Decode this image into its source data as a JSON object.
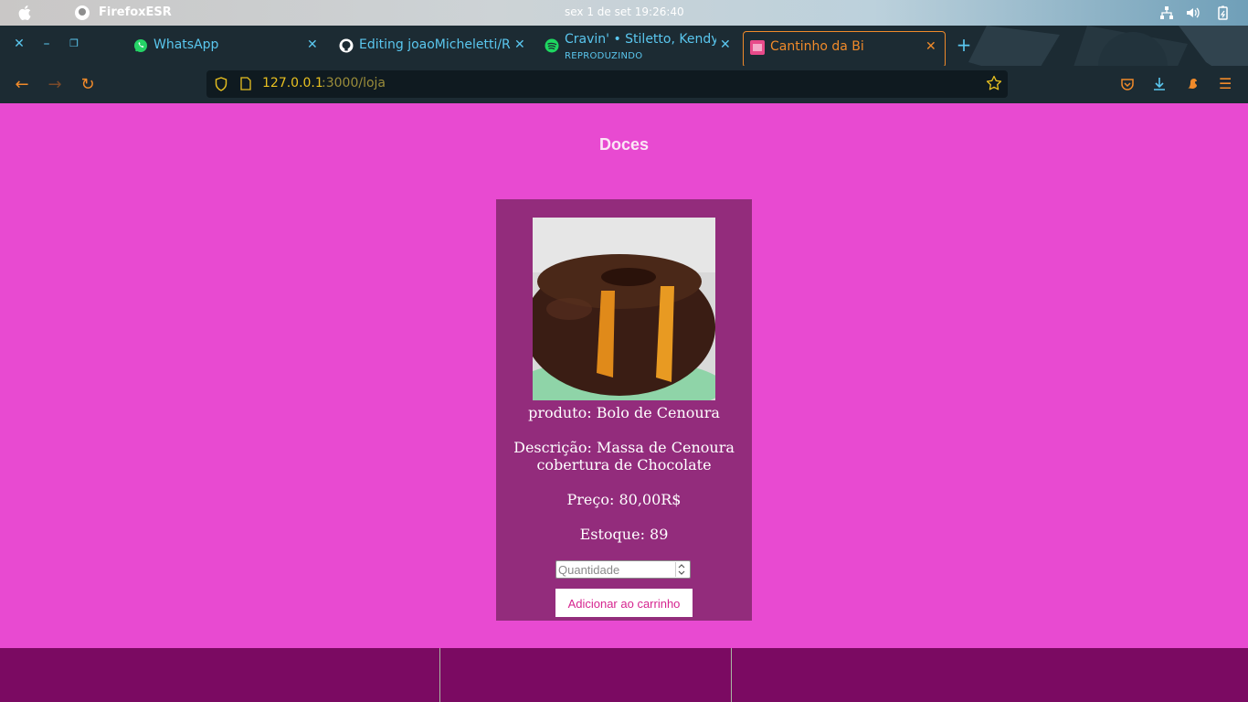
{
  "system_bar": {
    "app_name": "FirefoxESR",
    "clock": "sex 1 de set  19:26:40"
  },
  "tabs": [
    {
      "label": "WhatsApp",
      "icon": "whatsapp-icon"
    },
    {
      "label": "Editing joaoMicheletti/RE",
      "icon": "github-icon"
    },
    {
      "label": "Cravin' • Stiletto, Kendyle P",
      "sublabel": "REPRODUZINDO",
      "icon": "spotify-icon"
    },
    {
      "label": "Cantinho da Bi",
      "icon": "site-favicon",
      "active": true
    }
  ],
  "url": {
    "host": "127.0.0.1",
    "rest": ":3000/loja"
  },
  "page": {
    "title": "Doces",
    "product": {
      "name_line": "produto: Bolo de Cenoura",
      "desc_line1": "Descrição: Massa de Cenoura",
      "desc_line2": "cobertura de Chocolate",
      "price_line": "Preço: 80,00R$",
      "stock_line": "Estoque: 89",
      "quantity_placeholder": "Quantidade",
      "add_button": "Adicionar ao carrinho"
    }
  },
  "colors": {
    "page_bg": "#e84ad1",
    "card_bg": "#932c7c",
    "footer_bg": "#7b0a62",
    "accent": "#f08a2a",
    "tab_text": "#5ac7ef"
  }
}
